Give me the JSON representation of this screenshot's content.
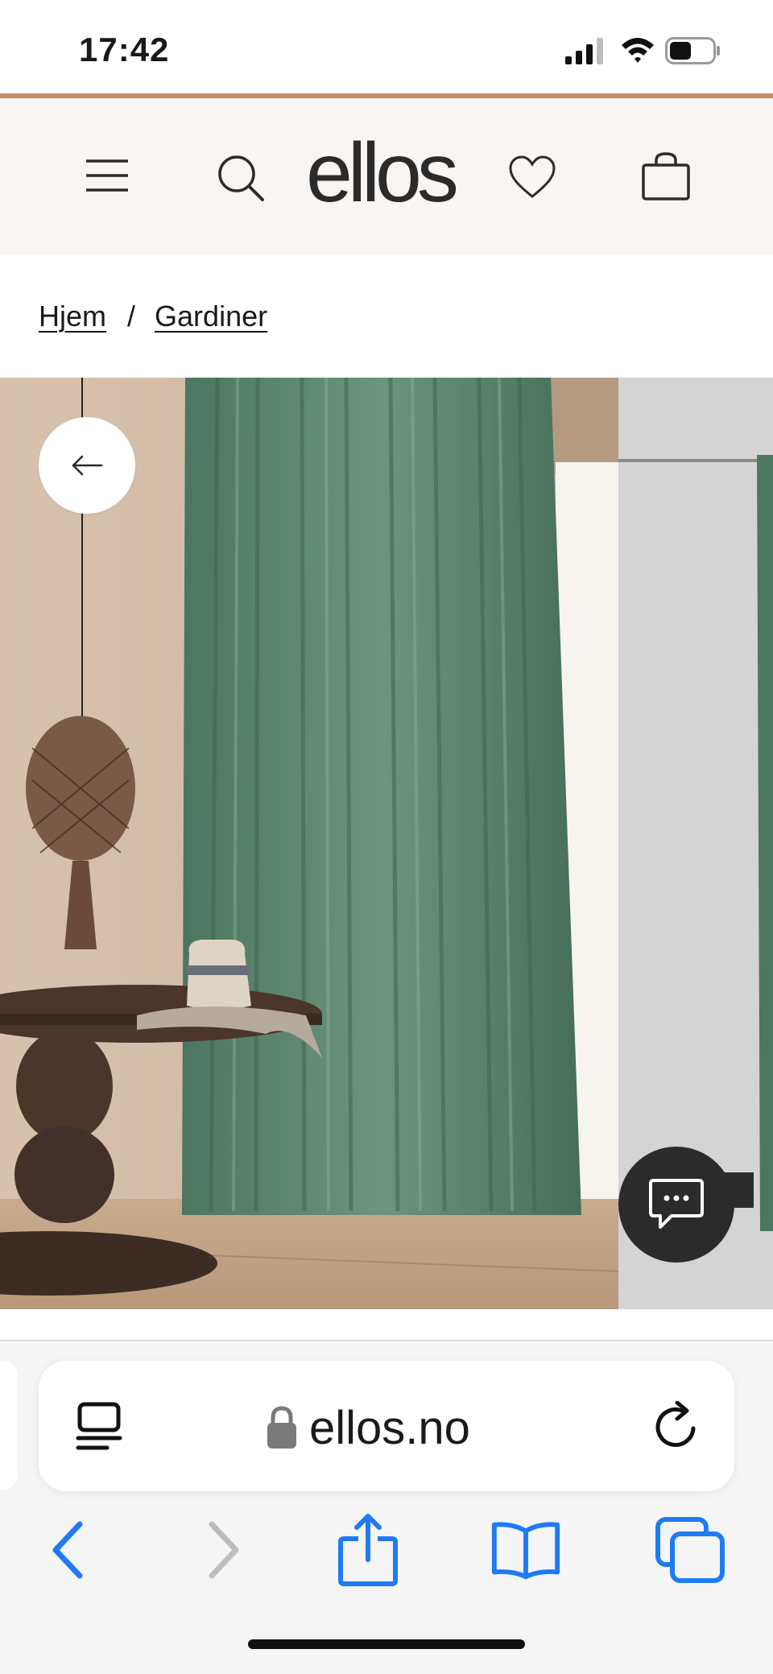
{
  "status_bar": {
    "time": "17:42",
    "battery_level": 0.5
  },
  "header": {
    "logo": "ellos",
    "icons": [
      "hamburger-icon",
      "search-icon",
      "heart-icon",
      "shopping-bag-icon"
    ]
  },
  "breadcrumb": {
    "items": [
      "Hjem",
      "Gardiner"
    ],
    "separator": "/"
  },
  "gallery": {
    "accent_curtain_color": "#4c7660",
    "prev_icon": "arrow-left-icon",
    "chat_icon": "chat-bubble-icon"
  },
  "browser": {
    "url": "ellos.no",
    "tint_color": "#1f7bf5",
    "toolbar": [
      "back-chevron-icon",
      "forward-chevron-icon",
      "share-icon",
      "bookmarks-icon",
      "tabs-icon"
    ]
  },
  "colors": {
    "accent_line": "#c98a68",
    "header_bg": "#f8f5f2"
  }
}
